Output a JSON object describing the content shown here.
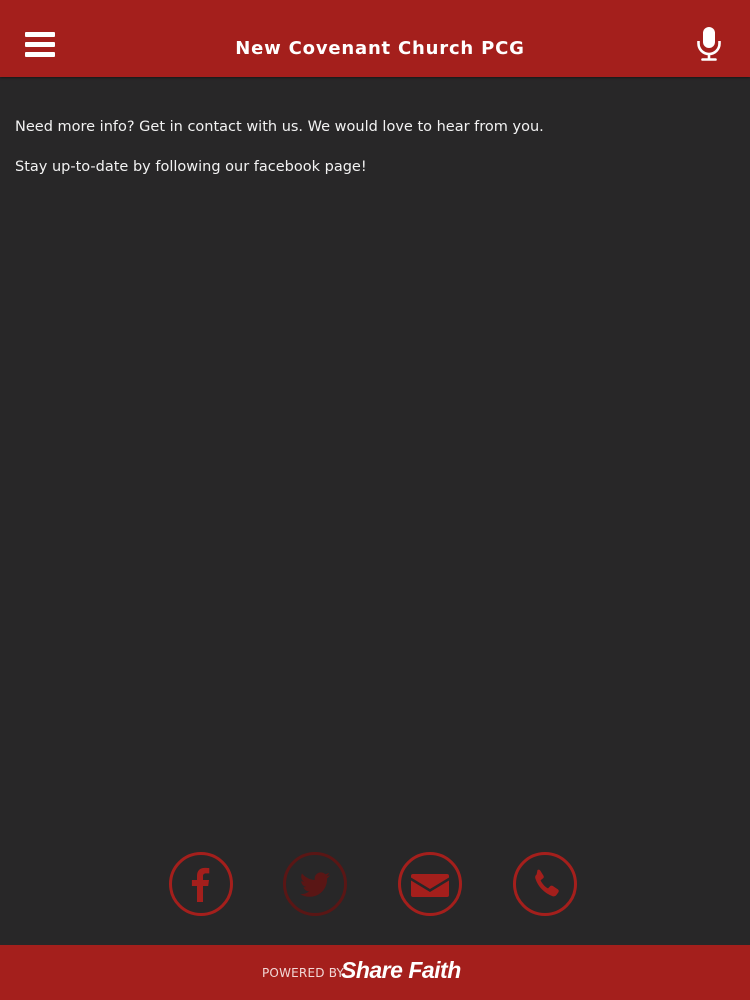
{
  "header": {
    "title": "New Covenant Church PCG",
    "menu_icon": "hamburger-menu-icon",
    "mic_icon": "microphone-icon"
  },
  "content": {
    "paragraphs": [
      "Need more info? Get in contact with us. We would love to hear from you.",
      "Stay up-to-date by following our facebook page!"
    ]
  },
  "social": [
    {
      "name": "facebook",
      "icon": "facebook-icon"
    },
    {
      "name": "twitter",
      "icon": "twitter-icon"
    },
    {
      "name": "email",
      "icon": "email-icon"
    },
    {
      "name": "phone",
      "icon": "phone-icon"
    }
  ],
  "footer": {
    "powered_by": "POWERED BY",
    "brand": "Share Faith"
  },
  "colors": {
    "brand_red": "#a41f1c",
    "background": "#282728",
    "text": "#f2f2f2"
  }
}
